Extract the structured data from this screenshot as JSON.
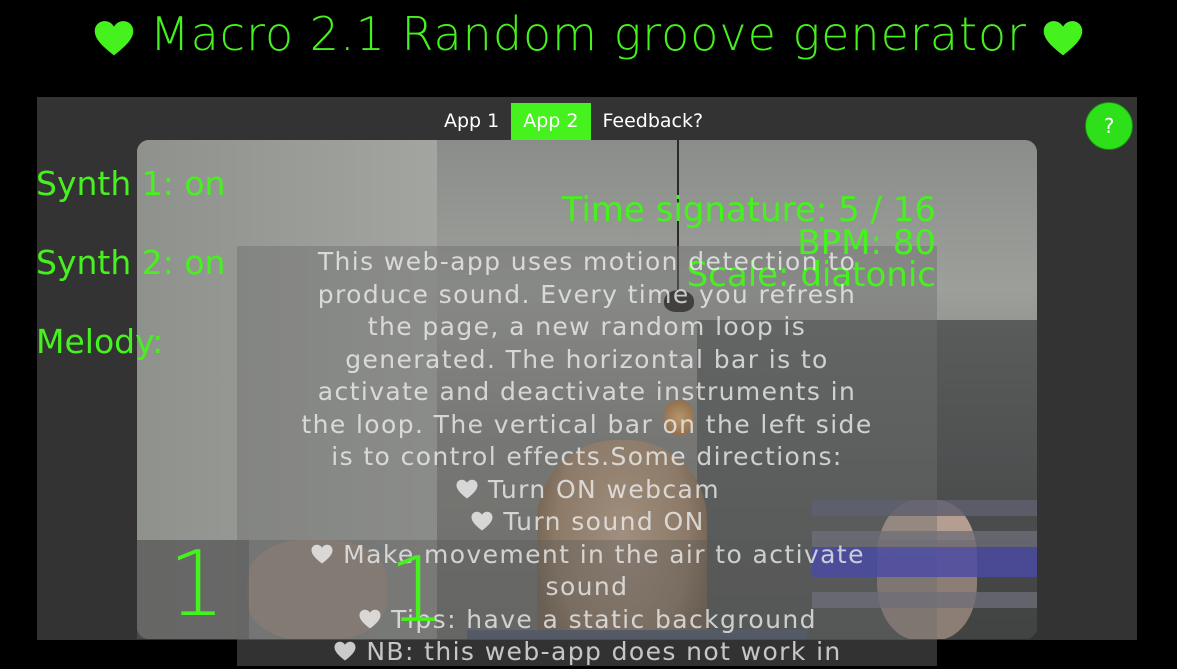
{
  "header": {
    "title": "Macro 2.1 Random groove generator",
    "heart_icon": "heart-icon",
    "color": "#46f21e"
  },
  "tabs": [
    {
      "label": "App 1",
      "active": false
    },
    {
      "label": "App 2",
      "active": true
    },
    {
      "label": "Feedback?",
      "active": false
    }
  ],
  "help_button": {
    "label": "?"
  },
  "synth_status": {
    "synth1": "Synth 1: on",
    "synth2": "Synth 2: on",
    "melody": "Melody:"
  },
  "params": {
    "time_signature": "Time signature: 5 / 16",
    "bpm": "BPM: 80",
    "scale": "Scale: diatonic"
  },
  "info_text": {
    "lines": [
      "This web-app uses motion detection to",
      "produce sound. Every time you refresh",
      "the page, a new random loop is",
      "generated. The horizontal bar is to",
      "activate and deactivate instruments in",
      "the loop. The vertical bar on the left side",
      "is to control effects.Some directions:"
    ],
    "bullets": [
      "Turn ON webcam",
      "Turn sound ON",
      "Make movement in the air to activate",
      "sound",
      "Tips: have a static background",
      "NB: this web-app does not work in"
    ]
  },
  "counters": {
    "left": "1",
    "right": "1"
  },
  "colors": {
    "accent": "#46f21e",
    "frame": "#333333",
    "bar_active": "#4a4aa8"
  }
}
